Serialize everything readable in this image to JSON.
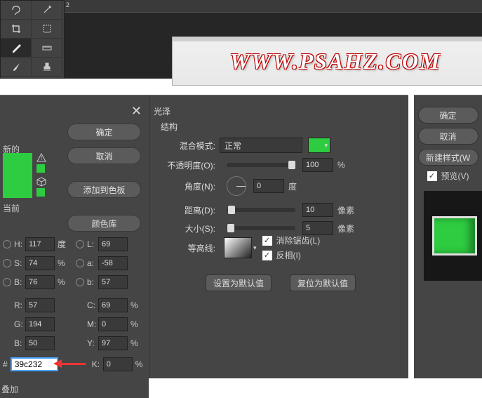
{
  "canvas": {
    "text": "WWW.PSAHZ.COM"
  },
  "color_picker": {
    "new_label": "新的",
    "current_label": "当前",
    "buttons": {
      "ok": "确定",
      "cancel": "取消",
      "add_swatch": "添加到色板",
      "libraries": "颜色库"
    },
    "hsb": {
      "h": "117",
      "s": "74",
      "b": "76",
      "h_unit": "度",
      "s_unit": "%",
      "b_unit": "%"
    },
    "lab": {
      "l": "69",
      "a": "-58",
      "b": "57"
    },
    "rgb": {
      "r": "57",
      "g": "194",
      "b": "50"
    },
    "cmyk": {
      "c": "69",
      "m": "0",
      "y": "97",
      "k": "0",
      "unit": "%"
    },
    "hex": "39c232",
    "labels": {
      "H": "H:",
      "S": "S:",
      "B": "B:",
      "L": "L:",
      "a": "a:",
      "b2": "b:",
      "R": "R:",
      "G": "G:",
      "Bl": "B:",
      "C": "C:",
      "M": "M:",
      "Y": "Y:",
      "K": "K:",
      "hash": "#"
    },
    "bottom": "叠加"
  },
  "satin": {
    "title": "光泽",
    "section": "结构",
    "blend_mode_label": "混合模式:",
    "blend_mode": "正常",
    "opacity_label": "不透明度(O):",
    "opacity": "100",
    "opacity_unit": "%",
    "angle_label": "角度(N):",
    "angle": "0",
    "angle_unit": "度",
    "distance_label": "距离(D):",
    "distance": "10",
    "distance_unit": "像素",
    "size_label": "大小(S):",
    "size": "5",
    "size_unit": "像素",
    "contour_label": "等高线:",
    "antialias": "消除锯齿(L)",
    "invert": "反相(I)",
    "make_default": "设置为默认值",
    "reset_default": "复位为默认值",
    "color": "#2ecc40"
  },
  "right": {
    "ok": "确定",
    "cancel": "取消",
    "new_style": "新建样式(W",
    "preview": "预览(V)"
  }
}
